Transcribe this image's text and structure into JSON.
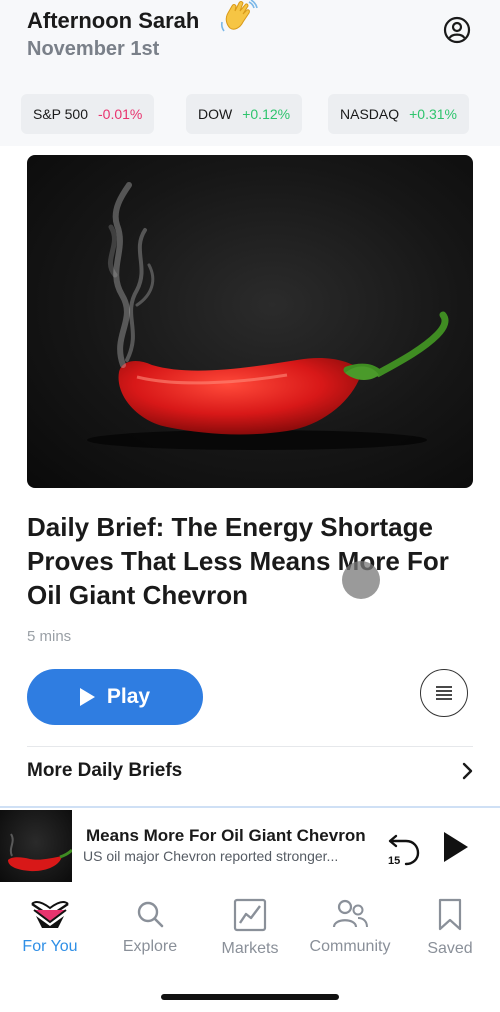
{
  "header": {
    "greeting": "Afternoon Sarah",
    "date": "November 1st",
    "wave_icon": "waving-hand-emoji",
    "account_icon": "user-circle-icon"
  },
  "tickers": [
    {
      "name": "S&P 500",
      "change": "-0.01%",
      "direction": "down"
    },
    {
      "name": "DOW",
      "change": "+0.12%",
      "direction": "up"
    },
    {
      "name": "NASDAQ",
      "change": "+0.31%",
      "direction": "up"
    }
  ],
  "article": {
    "title": "Daily Brief: The Energy Shortage Proves That Less Means More For Oil Giant Chevron",
    "read_time": "5 mins",
    "play_label": "Play"
  },
  "more_briefs": {
    "label": "More Daily Briefs"
  },
  "now_playing": {
    "title": "Means More For Oil Giant Chevron",
    "subtitle": "US oil major Chevron reported stronger...",
    "rewind_seconds": "15"
  },
  "tabs": [
    {
      "label": "For You",
      "icon": "for-you-icon",
      "active": true
    },
    {
      "label": "Explore",
      "icon": "search-icon",
      "active": false
    },
    {
      "label": "Markets",
      "icon": "chart-icon",
      "active": false
    },
    {
      "label": "Community",
      "icon": "people-icon",
      "active": false
    },
    {
      "label": "Saved",
      "icon": "bookmark-icon",
      "active": false
    }
  ],
  "colors": {
    "accent": "#2f7de1",
    "tab_active": "#2f8fe6",
    "negative": "#e8336e",
    "positive": "#2ec46d"
  }
}
